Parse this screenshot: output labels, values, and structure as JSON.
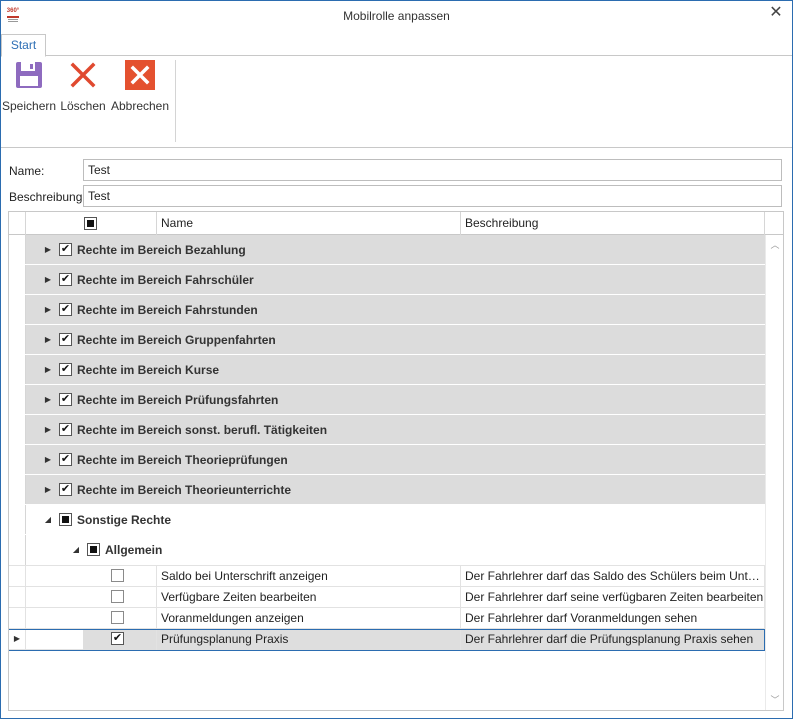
{
  "window": {
    "title": "Mobilrolle anpassen",
    "logo_text": "360°"
  },
  "ribbon": {
    "tab": "Start",
    "buttons": {
      "save": "Speichern",
      "delete": "Löschen",
      "cancel": "Abbrechen"
    }
  },
  "form": {
    "name_label": "Name:",
    "name_value": "Test",
    "description_label": "Beschreibung",
    "description_value": "Test"
  },
  "grid": {
    "columns": {
      "name": "Name",
      "description": "Beschreibung"
    },
    "groups": [
      "Rechte im Bereich Bezahlung",
      "Rechte im Bereich Fahrschüler",
      "Rechte im Bereich Fahrstunden",
      "Rechte im Bereich Gruppenfahrten",
      "Rechte im Bereich Kurse",
      "Rechte im Bereich Prüfungsfahrten",
      "Rechte im Bereich sonst. berufl. Tätigkeiten",
      "Rechte im Bereich Theorieprüfungen",
      "Rechte im Bereich Theorieunterrichte"
    ],
    "expanded_group": "Sonstige Rechte",
    "subgroup": "Allgemein",
    "rows": [
      {
        "name": "Saldo bei Unterschrift anzeigen",
        "description": "Der Fahrlehrer darf das Saldo des Schülers beim Unterschreiben sehen",
        "checked": false
      },
      {
        "name": "Verfügbare Zeiten bearbeiten",
        "description": "Der Fahrlehrer darf seine verfügbaren Zeiten bearbeiten",
        "checked": false
      },
      {
        "name": "Voranmeldungen anzeigen",
        "description": "Der Fahrlehrer darf Voranmeldungen sehen",
        "checked": false
      },
      {
        "name": "Prüfungsplanung Praxis",
        "description": "Der Fahrlehrer darf die Prüfungsplanung Praxis sehen",
        "checked": true
      }
    ]
  },
  "colors": {
    "accent": "#2b6cb0",
    "save_icon": "#8e6bbf",
    "delete_icon": "#e0492f",
    "cancel_icon": "#e4512f"
  }
}
